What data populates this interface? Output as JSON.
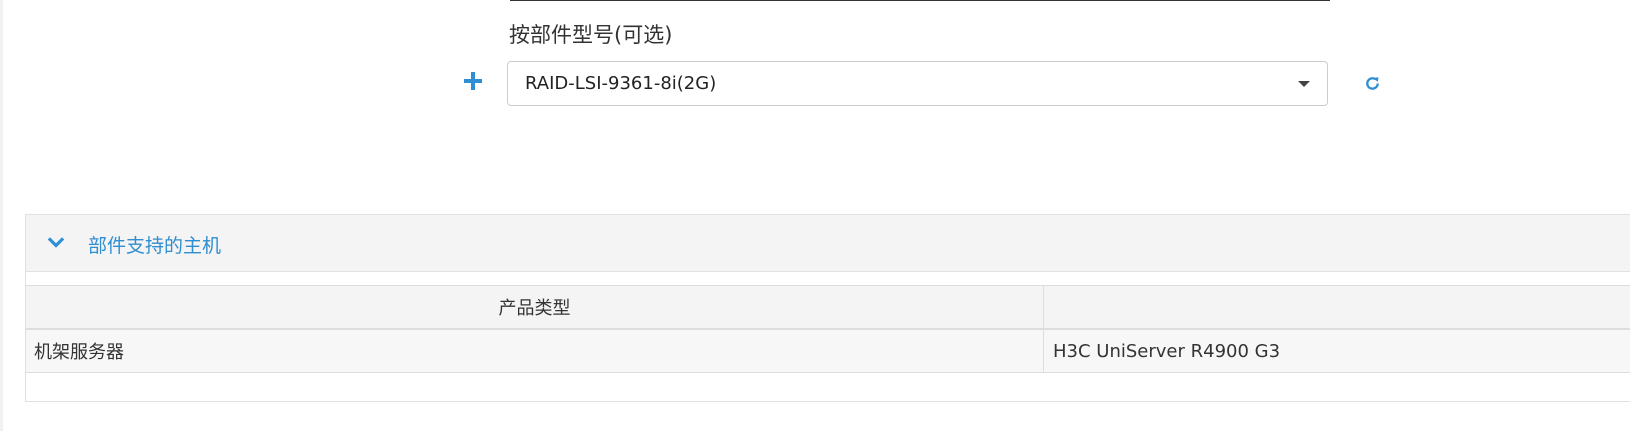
{
  "filter": {
    "label": "按部件型号(可选)",
    "selected_value": "RAID-LSI-9361-8i(2G)"
  },
  "icons": {
    "add": "plus-icon",
    "dropdown": "caret-down-icon",
    "refresh": "refresh-icon",
    "collapse": "chevron-down-icon"
  },
  "colors": {
    "accent": "#2e8fd4",
    "panel_title": "#2f8ecf"
  },
  "panel": {
    "title": "部件支持的主机",
    "table": {
      "columns": [
        "产品类型",
        ""
      ],
      "rows": [
        [
          "机架服务器",
          "H3C UniServer R4900 G3"
        ]
      ]
    }
  }
}
